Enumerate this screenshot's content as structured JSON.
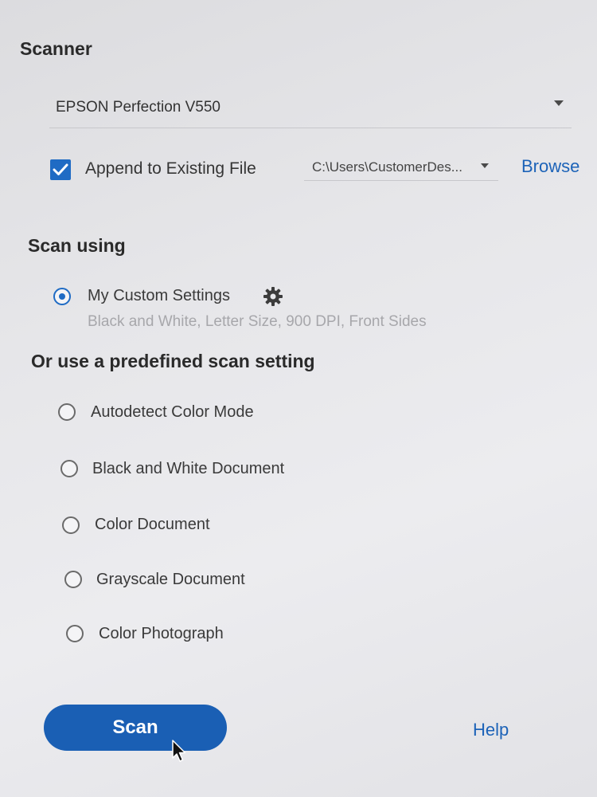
{
  "scanner": {
    "heading": "Scanner",
    "selected_device": "EPSON Perfection V550",
    "append": {
      "checked": true,
      "label": "Append to Existing File"
    },
    "file_path": "C:\\Users\\CustomerDes...",
    "browse_label": "Browse"
  },
  "scan_using": {
    "heading": "Scan using",
    "custom": {
      "label": "My Custom Settings",
      "selected": true,
      "description": "Black and White, Letter Size, 900 DPI, Front Sides"
    }
  },
  "predefined": {
    "heading": "Or use a predefined scan setting",
    "options": [
      {
        "label": "Autodetect Color Mode"
      },
      {
        "label": "Black and White Document"
      },
      {
        "label": "Color Document"
      },
      {
        "label": "Grayscale Document"
      },
      {
        "label": "Color Photograph"
      }
    ]
  },
  "actions": {
    "scan_label": "Scan",
    "help_label": "Help"
  },
  "colors": {
    "accent": "#1f6bc4",
    "button": "#1a5fb4",
    "link": "#1d63b8"
  },
  "icons": {
    "dropdown": "chevron-down-icon",
    "checkbox": "checkmark-icon",
    "settings": "gear-icon",
    "cursor": "mouse-pointer-icon"
  }
}
